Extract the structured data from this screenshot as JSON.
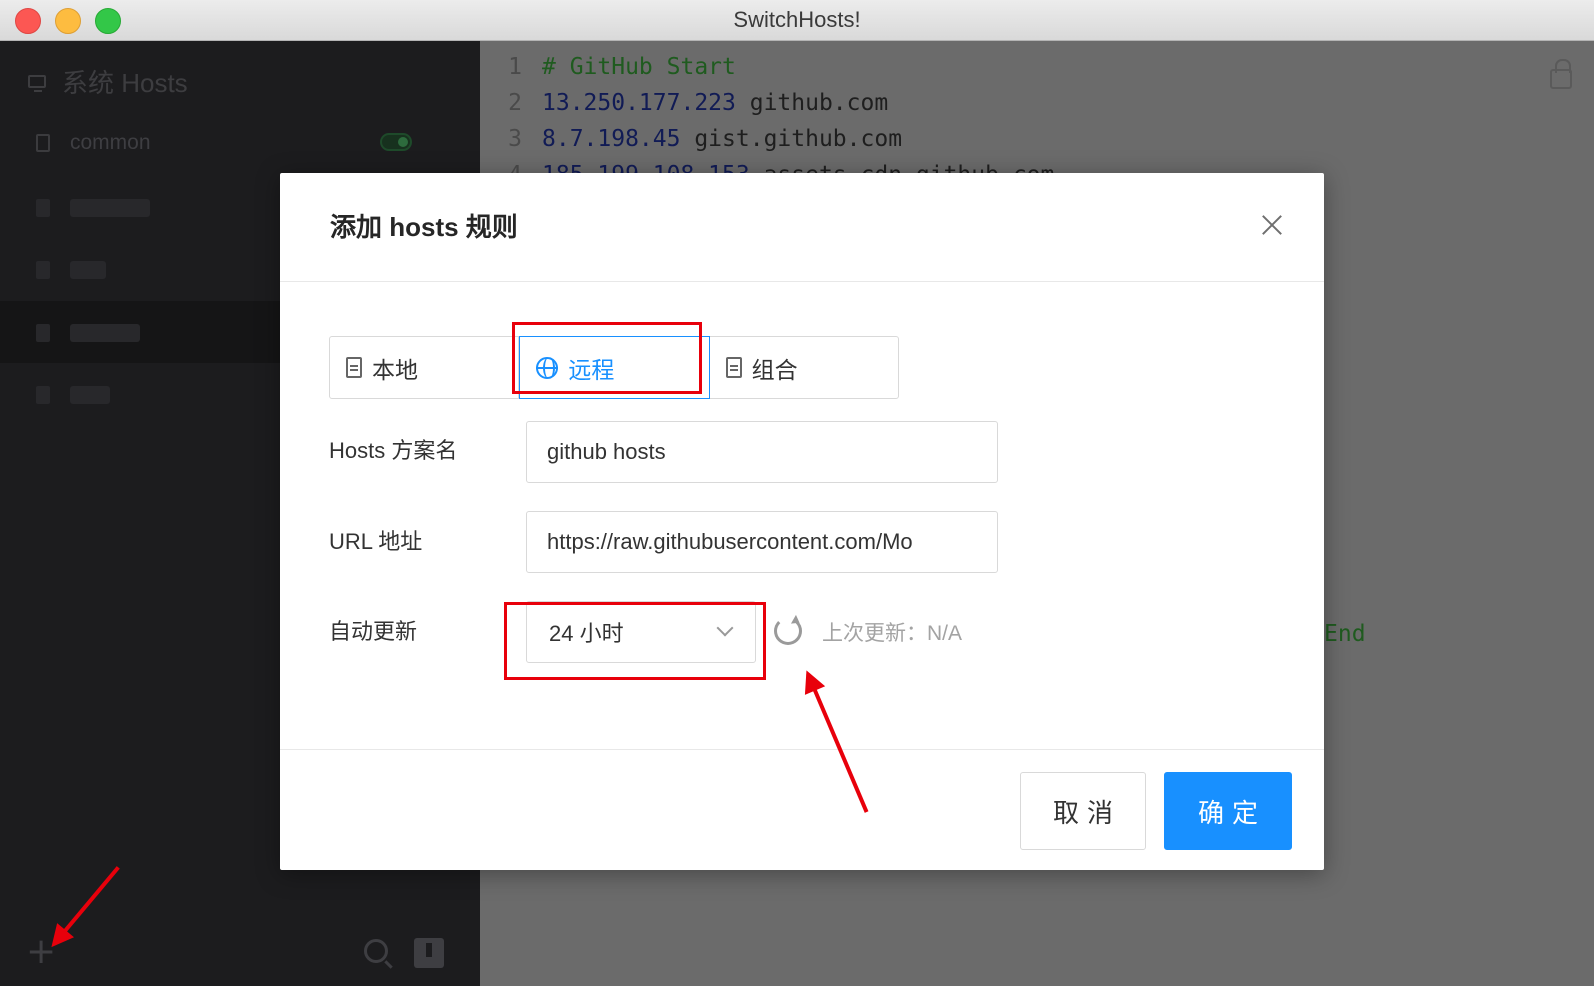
{
  "window": {
    "title": "SwitchHosts!"
  },
  "sidebar": {
    "system_label": "系统 Hosts",
    "items": [
      {
        "label": "common",
        "enabled": true
      }
    ]
  },
  "editor": {
    "lines": [
      {
        "num": "1",
        "ip": "",
        "host": "# GitHub Start",
        "type": "comment"
      },
      {
        "num": "2",
        "ip": "13.250.177.223",
        "host": " github.com",
        "type": "entry"
      },
      {
        "num": "3",
        "ip": "8.7.198.45",
        "host": " gist.github.com",
        "type": "entry"
      },
      {
        "num": "4",
        "ip": "185.199.108.153",
        "host": " assets-cdn.github.com",
        "type": "entry"
      }
    ],
    "end_text": "End"
  },
  "modal": {
    "title": "添加 hosts 规则",
    "types": [
      {
        "label": "本地",
        "icon": "file-icon",
        "active": false
      },
      {
        "label": "远程",
        "icon": "globe-icon",
        "active": true
      },
      {
        "label": "组合",
        "icon": "files-icon",
        "active": false
      }
    ],
    "name_label": "Hosts 方案名",
    "name_value": "github hosts",
    "url_label": "URL 地址",
    "url_value": "https://raw.githubusercontent.com/Mo",
    "auto_update_label": "自动更新",
    "auto_update_value": "24 小时",
    "last_update": "上次更新：N/A",
    "cancel_label": "取消",
    "ok_label": "确定"
  },
  "colors": {
    "accent": "#1890ff",
    "annotation": "#e8000b"
  }
}
